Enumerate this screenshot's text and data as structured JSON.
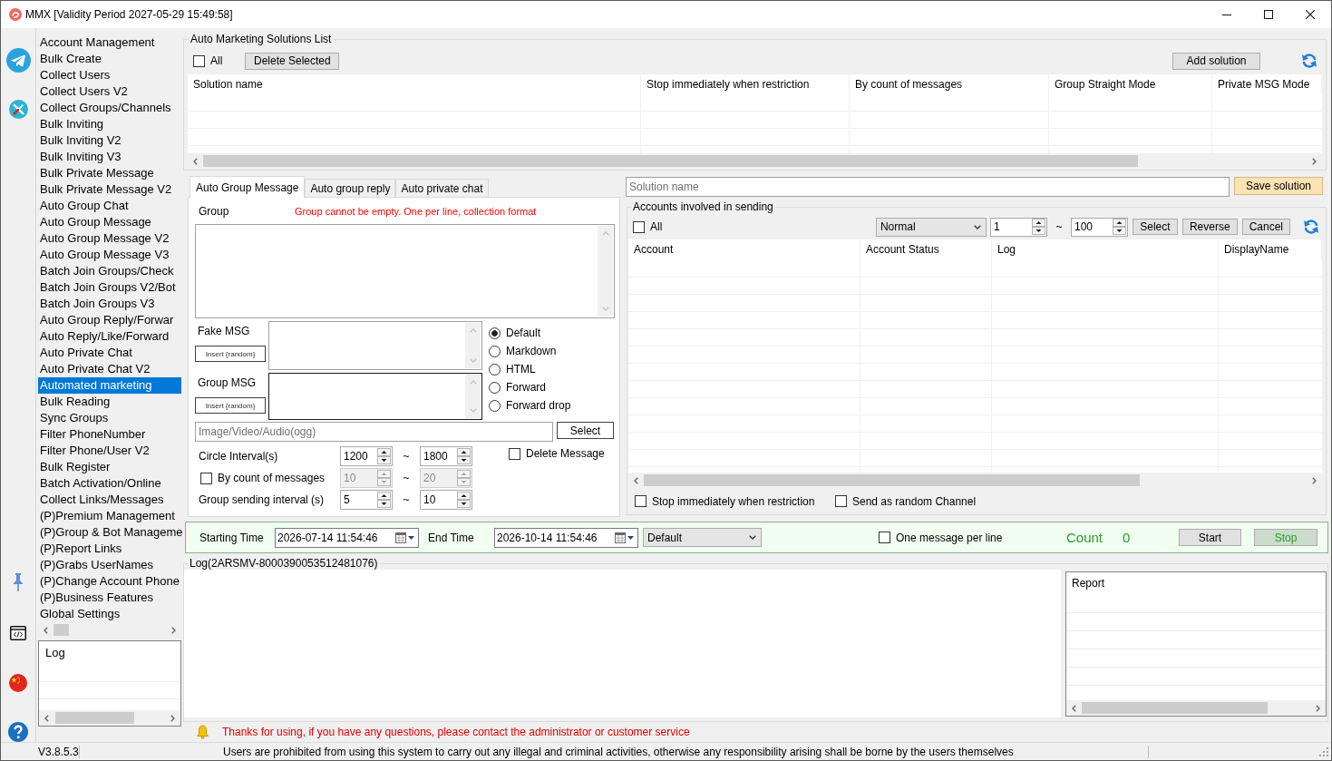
{
  "window": {
    "title": "MMX [Validity Period 2027-05-29 15:49:58]"
  },
  "sidebar": {
    "items": [
      {
        "label": "Account Management",
        "selected": false
      },
      {
        "label": "Bulk Create",
        "selected": false
      },
      {
        "label": "Collect Users",
        "selected": false
      },
      {
        "label": "Collect Users V2",
        "selected": false
      },
      {
        "label": "Collect Groups/Channels",
        "selected": false
      },
      {
        "label": "Bulk Inviting",
        "selected": false
      },
      {
        "label": "Bulk Inviting V2",
        "selected": false
      },
      {
        "label": "Bulk Inviting V3",
        "selected": false
      },
      {
        "label": "Bulk Private Message",
        "selected": false
      },
      {
        "label": "Bulk Private Message V2",
        "selected": false
      },
      {
        "label": "Auto Group Chat",
        "selected": false
      },
      {
        "label": "Auto Group Message",
        "selected": false
      },
      {
        "label": "Auto Group Message V2",
        "selected": false
      },
      {
        "label": "Auto Group Message V3",
        "selected": false
      },
      {
        "label": "Batch Join Groups/Check",
        "selected": false
      },
      {
        "label": "Batch Join Groups V2/Bot",
        "selected": false
      },
      {
        "label": "Batch Join Groups V3",
        "selected": false
      },
      {
        "label": "Auto Group Reply/Forwar",
        "selected": false
      },
      {
        "label": "Auto Reply/Like/Forward",
        "selected": false
      },
      {
        "label": "Auto Private Chat",
        "selected": false
      },
      {
        "label": "Auto Private Chat V2",
        "selected": false
      },
      {
        "label": "Automated marketing",
        "selected": true
      },
      {
        "label": "Bulk Reading",
        "selected": false
      },
      {
        "label": "Sync Groups",
        "selected": false
      },
      {
        "label": "Filter PhoneNumber",
        "selected": false
      },
      {
        "label": "Filter Phone/User V2",
        "selected": false
      },
      {
        "label": "Bulk Register",
        "selected": false
      },
      {
        "label": "Batch Activation/Online",
        "selected": false
      },
      {
        "label": "Collect Links/Messages",
        "selected": false
      },
      {
        "label": "(P)Premium Management",
        "selected": false
      },
      {
        "label": "(P)Group & Bot Manageme",
        "selected": false
      },
      {
        "label": "(P)Report Links",
        "selected": false
      },
      {
        "label": "(P)Grabs UserNames",
        "selected": false
      },
      {
        "label": "(P)Change Account Phone",
        "selected": false
      },
      {
        "label": "(P)Business Features",
        "selected": false
      },
      {
        "label": "Global Settings",
        "selected": false
      }
    ],
    "log_list": {
      "header": "Log"
    }
  },
  "solutions": {
    "title": "Auto Marketing Solutions List",
    "select_all": {
      "label": "All",
      "checked": false
    },
    "delete_button": "Delete Selected",
    "add_button": "Add solution",
    "table": {
      "columns": [
        "Solution name",
        "Stop immediately when restriction",
        "By count of messages",
        "Group Straight Mode",
        "Private MSG Mode"
      ]
    }
  },
  "tabs": [
    {
      "label": "Auto Group Message",
      "selected": true
    },
    {
      "label": "Auto group reply",
      "selected": false
    },
    {
      "label": "Auto private chat",
      "selected": false
    }
  ],
  "group_message": {
    "group_label": "Group",
    "group_hint": "Group cannot be empty. One per line, collection format",
    "messages": [
      {
        "label": "Fake MSG",
        "insert_button": "Insert {random}",
        "focused": false
      },
      {
        "label": "Group MSG",
        "insert_button": "Insert {random}",
        "focused": true
      }
    ],
    "parse_modes": [
      {
        "label": "Default",
        "selected": true
      },
      {
        "label": "Markdown",
        "selected": false
      },
      {
        "label": "HTML",
        "selected": false
      },
      {
        "label": "Forward",
        "selected": false
      },
      {
        "label": "Forward drop",
        "selected": false
      }
    ],
    "media_field": {
      "placeholder": "Image/Video/Audio(ogg)"
    },
    "select_button": "Select",
    "intervals": [
      {
        "kind": "label",
        "label": "Circle Interval(s)",
        "from": "1200",
        "separator": "~",
        "to": "1800",
        "disabled": false
      },
      {
        "kind": "checkbox",
        "label": "By count of messages",
        "checked": false,
        "from": "10",
        "separator": "~",
        "to": "20",
        "disabled": true
      },
      {
        "kind": "label",
        "label": "Group sending interval (s)",
        "from": "5",
        "separator": "~",
        "to": "10",
        "disabled": false
      }
    ],
    "delete_message": {
      "label": "Delete Message",
      "checked": false
    }
  },
  "solution_name": {
    "placeholder": "Solution name"
  },
  "save_button": "Save solution",
  "accounts": {
    "title": "Accounts involved in sending",
    "select_all": {
      "label": "All",
      "checked": false
    },
    "filter_dropdown": {
      "value": "Normal"
    },
    "range_from": "1",
    "separator": "~",
    "range_to": "100",
    "buttons": [
      "Select",
      "Reverse",
      "Cancel"
    ],
    "table": {
      "columns": [
        "Account",
        "Account Status",
        "Log",
        "DisplayName"
      ]
    },
    "options": [
      {
        "label": "Stop immediately when restriction",
        "checked": false
      },
      {
        "label": "Send as random Channel",
        "checked": false
      }
    ]
  },
  "schedule": {
    "start_label": "Starting Time",
    "start_value": "2026-07-14 11:54:46",
    "end_label": "End Time",
    "end_value": "2026-10-14 11:54:46",
    "mode_dropdown": {
      "value": "Default"
    },
    "one_per_line": {
      "label": "One message per line",
      "checked": false
    },
    "count_label": "Count",
    "count_value": "0",
    "start_button": "Start",
    "stop_button": "Stop"
  },
  "log": {
    "title": "Log(2ARSMV-8000390053512481076)",
    "report_header": "Report"
  },
  "notice": "Thanks for using, if you have any questions, please contact the administrator or customer service",
  "status_bar": {
    "version": "V3.8.5.3",
    "message": "Users are prohibited from using this system to carry out any illegal and criminal activities, otherwise any responsibility arising shall be borne by the users themselves"
  }
}
